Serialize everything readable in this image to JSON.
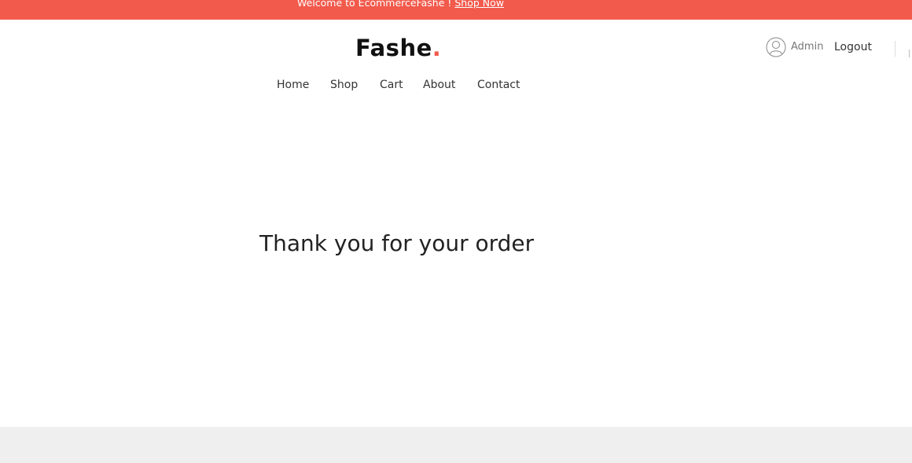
{
  "topbar": {
    "welcome_text": "Welcome to EcommerceFashe ! ",
    "shop_now_link": "Shop Now"
  },
  "header": {
    "logo_text": "Fashe",
    "logo_dot": "."
  },
  "nav": {
    "items": [
      {
        "label": "Home"
      },
      {
        "label": "Shop"
      },
      {
        "label": "Cart"
      },
      {
        "label": "About"
      },
      {
        "label": "Contact"
      }
    ]
  },
  "account": {
    "icon": "user-avatar-icon",
    "username": "Admin",
    "logout_label": "Logout"
  },
  "main": {
    "message": "Thank you for your order"
  },
  "colors": {
    "accent": "#f25a4c",
    "footer_bg": "#efefef"
  }
}
